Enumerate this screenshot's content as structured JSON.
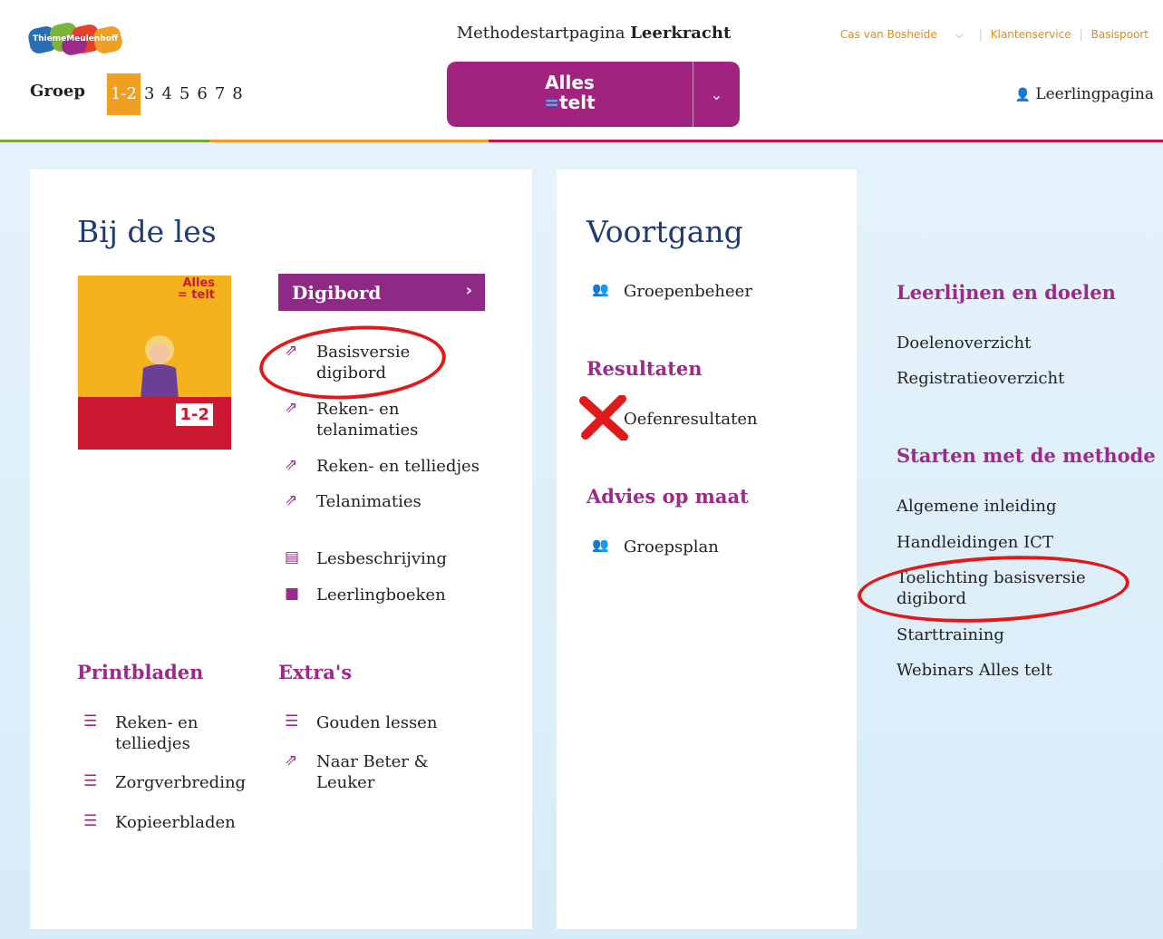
{
  "header": {
    "logo_text": "ThiemeMeulenhoff",
    "title_prefix": "Methodestartpagina",
    "title_bold": "Leerkracht",
    "method_logo_line1": "Alles",
    "method_logo_line2": "telt",
    "method_logo_eq": "=",
    "chevron": "⌄",
    "groep_label": "Groep",
    "groups": [
      "1-2",
      "3",
      "4",
      "5",
      "6",
      "7",
      "8"
    ],
    "active_group": "1-2",
    "topnav": {
      "user": "Cas van Bosheide",
      "user_chevron": "⌵",
      "klantenservice": "Klantenservice",
      "basispoort": "Basispoort"
    },
    "student_page": "Leerlingpagina"
  },
  "panel_lessons": {
    "title": "Bij de les",
    "cover": {
      "title_line1": "Alles",
      "title_line2": "= telt",
      "grade": "1-2"
    },
    "digibord": {
      "label": "Digibord",
      "chevron": "›"
    },
    "links": [
      "Basisversie digibord",
      "Reken- en telanimaties",
      "Reken- en telliedjes",
      "Telanimaties",
      "Lesbeschrijving",
      "Leerlingboeken"
    ],
    "printbladen": {
      "title": "Printbladen",
      "items": [
        "Reken- en telliedjes",
        "Zorgverbreding",
        "Kopieerbladen"
      ]
    },
    "extras": {
      "title": "Extra's",
      "items": [
        "Gouden lessen",
        "Naar Beter & Leuker"
      ]
    }
  },
  "panel_progress": {
    "title": "Voortgang",
    "groepenbeheer": "Groepenbeheer",
    "resultaten_title": "Resultaten",
    "oefenresultaten": "Oefenresultaten",
    "advies_title": "Advies op maat",
    "groepsplan": "Groepsplan"
  },
  "right_column": {
    "leerlijnen_title": "Leerlijnen en doelen",
    "leerlijnen_items": [
      "Doelenoverzicht",
      "Registratieoverzicht"
    ],
    "starten_title": "Starten met de methode",
    "starten_items": [
      "Algemene inleiding",
      "Handleidingen ICT",
      "Toelichting basisversie digibord",
      "Starttraining",
      "Webinars Alles telt"
    ]
  },
  "colors": {
    "purple": "#a0247f",
    "orange": "#f0a020",
    "title_blue": "#1e3a78",
    "annotation_red": "#e0191b"
  }
}
